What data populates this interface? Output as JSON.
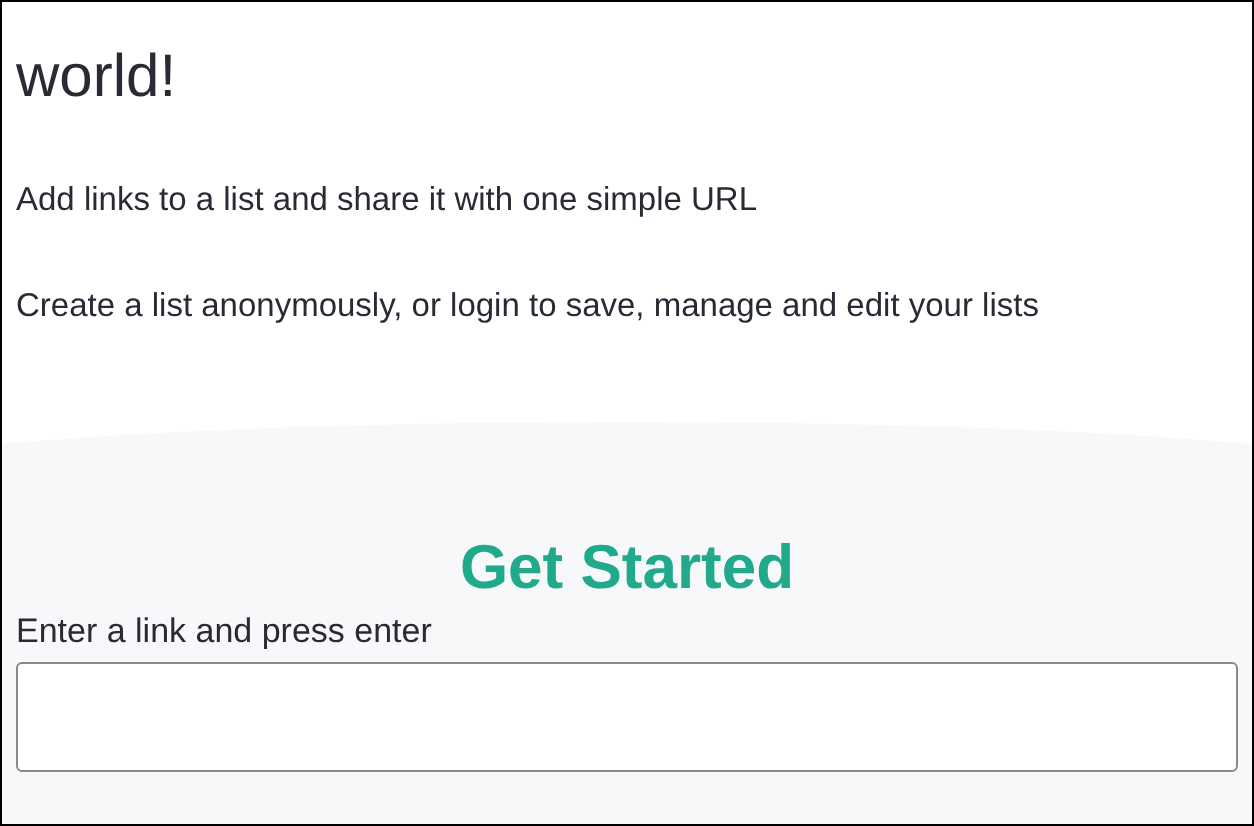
{
  "hero": {
    "heading": "world!",
    "paragraphs": [
      "Add links to a list and share it with one simple URL",
      "Create a list anonymously, or login to save, manage and edit your lists"
    ]
  },
  "get_started": {
    "title": "Get Started",
    "label": "Enter a link and press enter"
  }
}
